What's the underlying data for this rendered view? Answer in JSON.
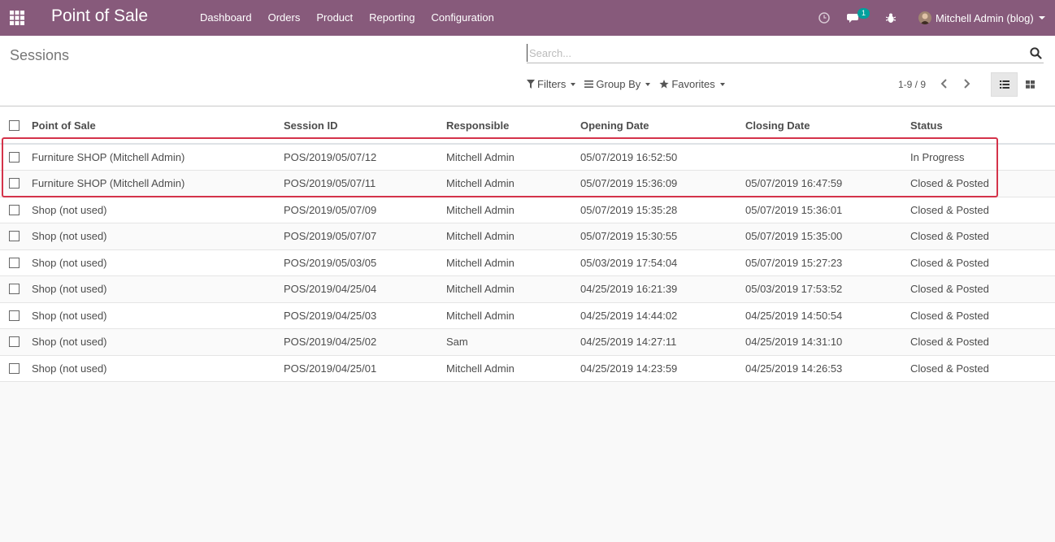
{
  "navbar": {
    "apps_icon": "apps-grid-icon",
    "brand": "Point of Sale",
    "menu": [
      "Dashboard",
      "Orders",
      "Product",
      "Reporting",
      "Configuration"
    ],
    "systray": {
      "clock_icon": "clock-icon",
      "chat_icon": "chat-icon",
      "chat_badge": "1",
      "debug_icon": "bug-icon",
      "user_name": "Mitchell Admin (blog)"
    },
    "color": "#875a7b"
  },
  "control_panel": {
    "breadcrumb": "Sessions",
    "search_placeholder": "Search...",
    "filters_label": "Filters",
    "groupby_label": "Group By",
    "favorites_label": "Favorites",
    "pager": "1-9 / 9"
  },
  "table": {
    "columns": [
      "Point of Sale",
      "Session ID",
      "Responsible",
      "Opening Date",
      "Closing Date",
      "Status"
    ],
    "rows": [
      [
        "Furniture SHOP (Mitchell Admin)",
        "POS/2019/05/07/12",
        "Mitchell Admin",
        "05/07/2019 16:52:50",
        "",
        "In Progress"
      ],
      [
        "Furniture SHOP (Mitchell Admin)",
        "POS/2019/05/07/11",
        "Mitchell Admin",
        "05/07/2019 15:36:09",
        "05/07/2019 16:47:59",
        "Closed & Posted"
      ],
      [
        "Shop (not used)",
        "POS/2019/05/07/09",
        "Mitchell Admin",
        "05/07/2019 15:35:28",
        "05/07/2019 15:36:01",
        "Closed & Posted"
      ],
      [
        "Shop (not used)",
        "POS/2019/05/07/07",
        "Mitchell Admin",
        "05/07/2019 15:30:55",
        "05/07/2019 15:35:00",
        "Closed & Posted"
      ],
      [
        "Shop (not used)",
        "POS/2019/05/03/05",
        "Mitchell Admin",
        "05/03/2019 17:54:04",
        "05/07/2019 15:27:23",
        "Closed & Posted"
      ],
      [
        "Shop (not used)",
        "POS/2019/04/25/04",
        "Mitchell Admin",
        "04/25/2019 16:21:39",
        "05/03/2019 17:53:52",
        "Closed & Posted"
      ],
      [
        "Shop (not used)",
        "POS/2019/04/25/03",
        "Mitchell Admin",
        "04/25/2019 14:44:02",
        "04/25/2019 14:50:54",
        "Closed & Posted"
      ],
      [
        "Shop (not used)",
        "POS/2019/04/25/02",
        "Sam",
        "04/25/2019 14:27:11",
        "04/25/2019 14:31:10",
        "Closed & Posted"
      ],
      [
        "Shop (not used)",
        "POS/2019/04/25/01",
        "Mitchell Admin",
        "04/25/2019 14:23:59",
        "04/25/2019 14:26:53",
        "Closed & Posted"
      ]
    ],
    "highlight_color": "#d4334a"
  }
}
